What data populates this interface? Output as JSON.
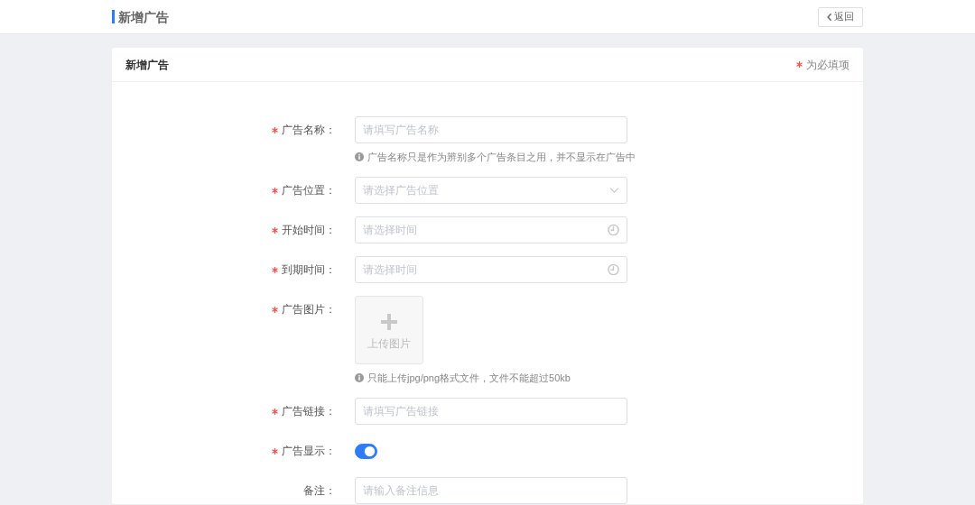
{
  "header": {
    "title": "新增广告",
    "back_button": "返回"
  },
  "card": {
    "title": "新增广告",
    "required_note": "为必填项"
  },
  "fields": [
    {
      "kind": "text",
      "required": true,
      "label": "广告名称：",
      "placeholder": "请填写广告名称",
      "help": "广告名称只是作为辨别多个广告条目之用，并不显示在广告中"
    },
    {
      "kind": "select",
      "required": true,
      "label": "广告位置：",
      "placeholder": "请选择广告位置"
    },
    {
      "kind": "time",
      "required": true,
      "label": "开始时间：",
      "placeholder": "请选择时间"
    },
    {
      "kind": "time",
      "required": true,
      "label": "到期时间：",
      "placeholder": "请选择时间"
    },
    {
      "kind": "upload",
      "required": true,
      "label": "广告图片：",
      "upload_label": "上传图片",
      "help": "只能上传jpg/png格式文件，文件不能超过50kb"
    },
    {
      "kind": "text",
      "required": true,
      "label": "广告链接：",
      "placeholder": "请填写广告链接"
    },
    {
      "kind": "switch",
      "required": true,
      "label": "广告显示：",
      "on": true
    },
    {
      "kind": "text",
      "required": false,
      "label": "备注：",
      "placeholder": "请输入备注信息"
    }
  ]
}
